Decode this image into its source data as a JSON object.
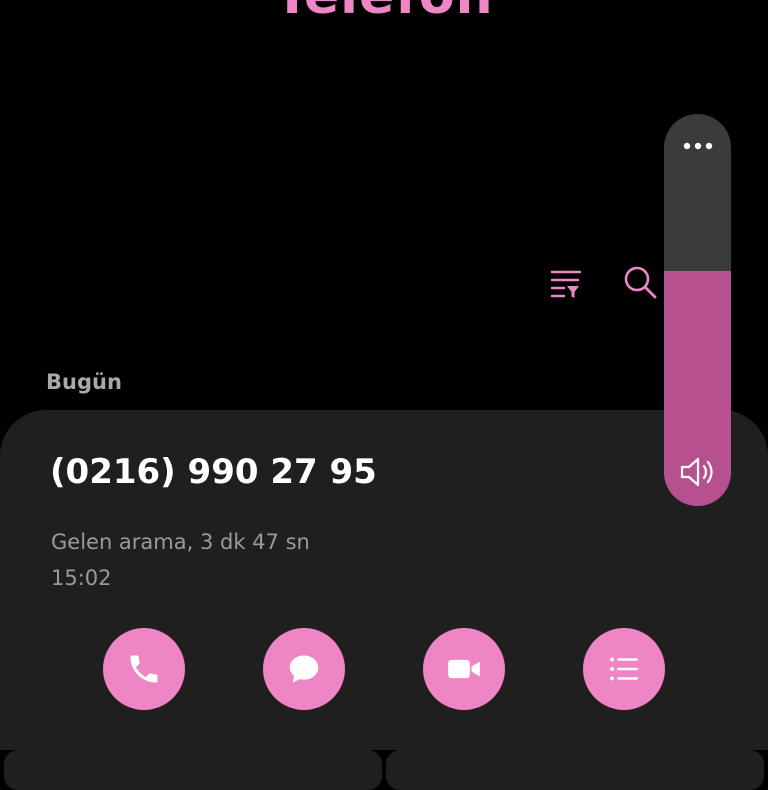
{
  "header": {
    "title": "Telefon"
  },
  "toolbar": {
    "filter_icon": "filter-list-icon",
    "search_icon": "search-icon"
  },
  "call_log": {
    "section_label": "Bugün",
    "entry": {
      "number": "(0216) 990 27 95",
      "detail": "Gelen arama, 3 dk 47 sn",
      "time": "15:02",
      "actions": [
        {
          "icon": "phone-icon"
        },
        {
          "icon": "message-icon"
        },
        {
          "icon": "video-call-icon"
        },
        {
          "icon": "details-list-icon"
        }
      ]
    }
  },
  "volume": {
    "level_percent": 60,
    "more_icon": "more-horizontal-icon",
    "speaker_icon": "speaker-icon"
  },
  "colors": {
    "background": "#000000",
    "card": "#1f1f1f",
    "accent": "#ee86c5",
    "volume_fill": "#b6508e",
    "volume_track": "#3b3b3b",
    "secondary_text": "#9a9a9a"
  }
}
